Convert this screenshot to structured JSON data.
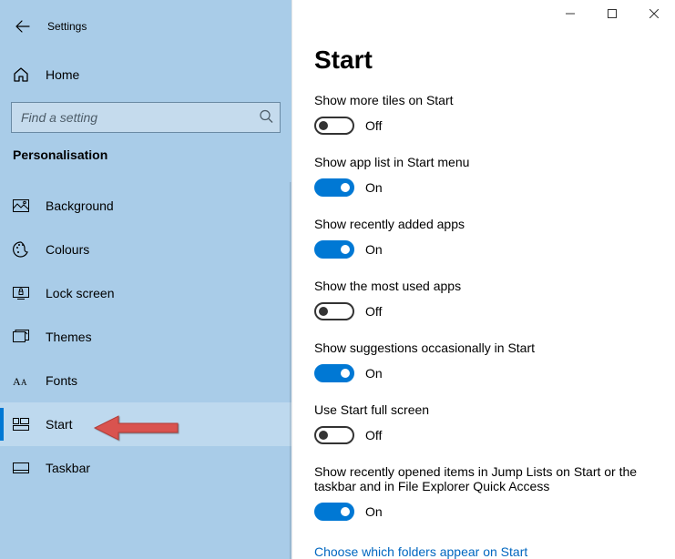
{
  "window": {
    "title": "Settings"
  },
  "sidebar": {
    "home_label": "Home",
    "search_placeholder": "Find a setting",
    "category": "Personalisation",
    "items": [
      {
        "label": "Background",
        "icon": "background-icon"
      },
      {
        "label": "Colours",
        "icon": "colours-icon"
      },
      {
        "label": "Lock screen",
        "icon": "lock-screen-icon"
      },
      {
        "label": "Themes",
        "icon": "themes-icon"
      },
      {
        "label": "Fonts",
        "icon": "fonts-icon"
      },
      {
        "label": "Start",
        "icon": "start-icon",
        "selected": true
      },
      {
        "label": "Taskbar",
        "icon": "taskbar-icon"
      }
    ]
  },
  "main": {
    "title": "Start",
    "settings": [
      {
        "label": "Show more tiles on Start",
        "state": "Off",
        "on": false
      },
      {
        "label": "Show app list in Start menu",
        "state": "On",
        "on": true
      },
      {
        "label": "Show recently added apps",
        "state": "On",
        "on": true
      },
      {
        "label": "Show the most used apps",
        "state": "Off",
        "on": false
      },
      {
        "label": "Show suggestions occasionally in Start",
        "state": "On",
        "on": true
      },
      {
        "label": "Use Start full screen",
        "state": "Off",
        "on": false
      },
      {
        "label": "Show recently opened items in Jump Lists on Start or the taskbar and in File Explorer Quick Access",
        "state": "On",
        "on": true
      }
    ],
    "link": "Choose which folders appear on Start"
  }
}
